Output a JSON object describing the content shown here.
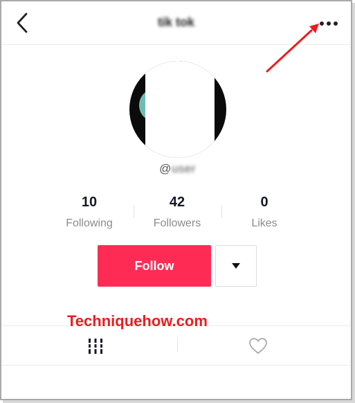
{
  "header": {
    "title": "tik tok",
    "back_icon": "chevron-left-icon",
    "more_icon": "more-horizontal-icon"
  },
  "annotation": {
    "arrow_color": "#e81e1e"
  },
  "profile": {
    "username_prefix": "@",
    "username_rest": "user"
  },
  "stats": [
    {
      "value": "10",
      "label": "Following"
    },
    {
      "value": "42",
      "label": "Followers"
    },
    {
      "value": "0",
      "label": "Likes"
    }
  ],
  "actions": {
    "follow_label": "Follow",
    "follow_color": "#fe2c55",
    "dropdown_icon": "caret-down-icon"
  },
  "watermark": {
    "text": "Techniquehow.com",
    "color": "#e81e1e"
  },
  "tabs": {
    "videos_icon": "grid-icon",
    "likes_icon": "heart-icon"
  }
}
